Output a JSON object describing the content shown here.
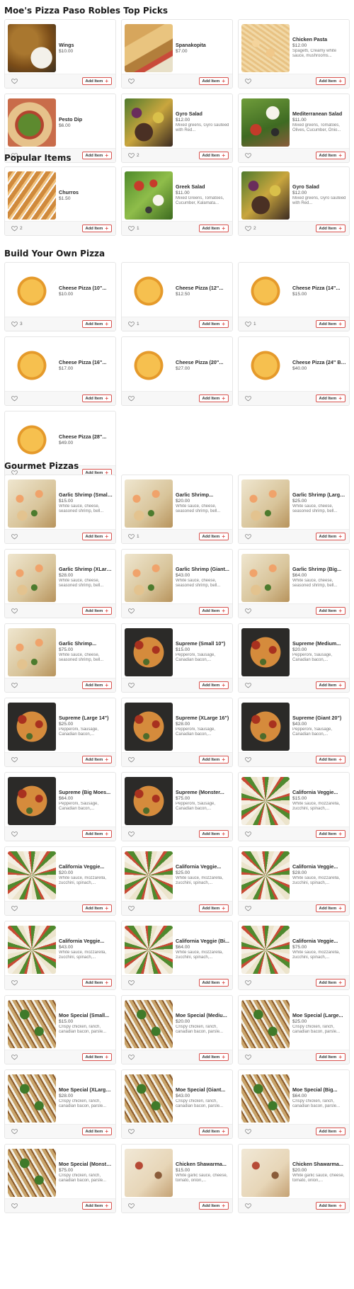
{
  "labels": {
    "add_item": "Add Item",
    "plus": "+"
  },
  "sections": [
    {
      "title": "Moe's Pizza Paso Robles Top Picks",
      "items": [
        {
          "name": "Wings",
          "price": "$10.00",
          "desc": "",
          "likes": "",
          "image": "wings"
        },
        {
          "name": "Spanakopita",
          "price": "$7.00",
          "desc": "",
          "likes": "",
          "image": "spanakopita"
        },
        {
          "name": "Chicken Pasta",
          "price": "$12.00",
          "desc": "Spagetti, Creamy white sauce, mushrooms...",
          "likes": "",
          "image": "chickenpasta"
        },
        {
          "name": "Pesto Dip",
          "price": "$6.00",
          "desc": "",
          "likes": "",
          "image": "pesto"
        },
        {
          "name": "Gyro Salad",
          "price": "$12.00",
          "desc": "Mixed greens, Gyro sauteed with Red...",
          "likes": "2",
          "image": "gyro"
        },
        {
          "name": "Mediterranean Salad",
          "price": "$11.00",
          "desc": "Mixed greens, Tomatoes, Olives, Cucumber, Onio...",
          "likes": "",
          "image": "medsalad"
        }
      ]
    },
    {
      "title": "Popular Items",
      "items": [
        {
          "name": "Churros",
          "price": "$1.50",
          "desc": "",
          "likes": "2",
          "image": "churros"
        },
        {
          "name": "Greek Salad",
          "price": "$11.00",
          "desc": "Mixed Greens, Tomatoes, Cucumber, Kalamata...",
          "likes": "1",
          "image": "greeksalad"
        },
        {
          "name": "Gyro Salad",
          "price": "$12.00",
          "desc": "Mixed greens, Gyro sauteed with Red...",
          "likes": "2",
          "image": "gyro"
        }
      ]
    },
    {
      "title": "Build Your Own Pizza",
      "items": [
        {
          "name": "Cheese Pizza (10\"...",
          "price": "$10.00",
          "desc": "",
          "likes": "3",
          "image": "pizza"
        },
        {
          "name": "Cheese Pizza (12\"...",
          "price": "$12.50",
          "desc": "",
          "likes": "1",
          "image": "pizza"
        },
        {
          "name": "Cheese Pizza (14\"...",
          "price": "$15.00",
          "desc": "",
          "likes": "1",
          "image": "pizza"
        },
        {
          "name": "Cheese Pizza (16\"...",
          "price": "$17.00",
          "desc": "",
          "likes": "",
          "image": "pizza"
        },
        {
          "name": "Cheese Pizza (20\"...",
          "price": "$27.00",
          "desc": "",
          "likes": "",
          "image": "pizza"
        },
        {
          "name": "Cheese Pizza (24\" Bi...",
          "price": "$40.00",
          "desc": "",
          "likes": "",
          "image": "pizza"
        },
        {
          "name": "Cheese Pizza (28\"...",
          "price": "$49.00",
          "desc": "",
          "likes": "",
          "image": "pizza"
        }
      ]
    },
    {
      "title": "Gourmet Pizzas",
      "items": [
        {
          "name": "Garlic Shrimp (Small...",
          "price": "$15.00",
          "desc": "White sauce, cheese, seasoned shrimp, bell...",
          "likes": "",
          "image": "shrimp"
        },
        {
          "name": "Garlic Shrimp...",
          "price": "$20.00",
          "desc": "White sauce, cheese, seasoned shrimp, bell...",
          "likes": "1",
          "image": "shrimp"
        },
        {
          "name": "Garlic Shrimp (Large...",
          "price": "$25.00",
          "desc": "White sauce, cheese, seasoned shrimp, bell...",
          "likes": "",
          "image": "shrimp"
        },
        {
          "name": "Garlic Shrimp (XLarg...",
          "price": "$28.00",
          "desc": "White sauce, cheese, seasoned shrimp, bell...",
          "likes": "",
          "image": "shrimp"
        },
        {
          "name": "Garlic Shrimp (Giant...",
          "price": "$43.00",
          "desc": "White sauce, cheese, seasoned shrimp, bell...",
          "likes": "",
          "image": "shrimp"
        },
        {
          "name": "Garlic Shrimp (Big...",
          "price": "$64.00",
          "desc": "White sauce, cheese, seasoned shrimp, bell...",
          "likes": "",
          "image": "shrimp"
        },
        {
          "name": "Garlic Shrimp...",
          "price": "$75.00",
          "desc": "White sauce, cheese, seasoned shrimp, bell...",
          "likes": "",
          "image": "shrimp"
        },
        {
          "name": "Supreme (Small 10\")",
          "price": "$15.00",
          "desc": "Pepperoni, Sausage, Canadian bacon,...",
          "likes": "",
          "image": "supreme"
        },
        {
          "name": "Supreme (Medium...",
          "price": "$20.00",
          "desc": "Pepperoni, Sausage, Canadian bacon,...",
          "likes": "",
          "image": "supreme"
        },
        {
          "name": "Supreme (Large 14\")",
          "price": "$25.00",
          "desc": "Pepperoni, Sausage, Canadian bacon,...",
          "likes": "",
          "image": "supreme"
        },
        {
          "name": "Supreme (XLarge 16\")",
          "price": "$28.00",
          "desc": "Pepperoni, Sausage, Canadian bacon,...",
          "likes": "",
          "image": "supreme"
        },
        {
          "name": "Supreme (Giant 20\")",
          "price": "$43.00",
          "desc": "Pepperoni, Sausage, Canadian bacon,...",
          "likes": "",
          "image": "supreme"
        },
        {
          "name": "Supreme (Big Moes...",
          "price": "$64.00",
          "desc": "Pepperoni, Sausage, Canadian bacon,...",
          "likes": "",
          "image": "supreme"
        },
        {
          "name": "Supreme (Monster...",
          "price": "$75.00",
          "desc": "Pepperoni, Sausage, Canadian bacon,...",
          "likes": "",
          "image": "supreme"
        },
        {
          "name": "California Veggie...",
          "price": "$15.00",
          "desc": "White sauce, mozzarella, zucchini, spinach,...",
          "likes": "",
          "image": "california"
        },
        {
          "name": "California Veggie...",
          "price": "$20.00",
          "desc": "White sauce, mozzarella, zucchini, spinach,...",
          "likes": "",
          "image": "california"
        },
        {
          "name": "California Veggie...",
          "price": "$25.00",
          "desc": "White sauce, mozzarella, zucchini, spinach,...",
          "likes": "",
          "image": "california"
        },
        {
          "name": "California Veggie...",
          "price": "$28.00",
          "desc": "White sauce, mozzarella, zucchini, spinach,...",
          "likes": "",
          "image": "california"
        },
        {
          "name": "California Veggie...",
          "price": "$43.00",
          "desc": "White sauce, mozzarella, zucchini, spinach,...",
          "likes": "",
          "image": "california"
        },
        {
          "name": "California Veggie (Bi...",
          "price": "$64.00",
          "desc": "White sauce, mozzarella, zucchini, spinach,...",
          "likes": "",
          "image": "california"
        },
        {
          "name": "California Veggie...",
          "price": "$75.00",
          "desc": "White sauce, mozzarella, zucchini, spinach,...",
          "likes": "",
          "image": "california"
        },
        {
          "name": "Moe Special (Small...",
          "price": "$15.00",
          "desc": "Crispy chicken, ranch, canadian bacon, parsle...",
          "likes": "",
          "image": "moespecial"
        },
        {
          "name": "Moe Special (Mediu...",
          "price": "$20.00",
          "desc": "Crispy chicken, ranch, canadian bacon, parsle...",
          "likes": "",
          "image": "moespecial"
        },
        {
          "name": "Moe Special (Large...",
          "price": "$25.00",
          "desc": "Crispy chicken, ranch, canadian bacon, parsle...",
          "likes": "",
          "image": "moespecial"
        },
        {
          "name": "Moe Special (XLarge...",
          "price": "$28.00",
          "desc": "Crispy chicken, ranch, canadian bacon, parsle...",
          "likes": "",
          "image": "moespecial"
        },
        {
          "name": "Moe Special (Giant...",
          "price": "$43.00",
          "desc": "Crispy chicken, ranch, canadian bacon, parsle...",
          "likes": "",
          "image": "moespecial"
        },
        {
          "name": "Moe Special (Big...",
          "price": "$64.00",
          "desc": "Crispy chicken, ranch, canadian bacon, parsle...",
          "likes": "",
          "image": "moespecial"
        },
        {
          "name": "Moe Special (Monste...",
          "price": "$75.00",
          "desc": "Crispy chicken, ranch, canadian bacon, parsle...",
          "likes": "",
          "image": "moespecial"
        },
        {
          "name": "Chicken Shawarma...",
          "price": "$15.00",
          "desc": "White garlic sauce, cheese, tomato, onion,...",
          "likes": "",
          "image": "shawarma"
        },
        {
          "name": "Chicken Shawarma...",
          "price": "$20.00",
          "desc": "White garlic sauce, cheese, tomato, onion,...",
          "likes": "",
          "image": "shawarma"
        }
      ]
    }
  ]
}
